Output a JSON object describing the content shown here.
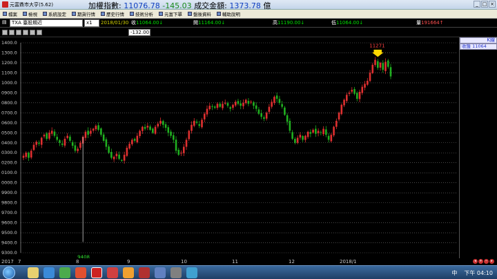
{
  "app": {
    "title": "元富鼎市大亨(5.62)",
    "index_label": "加權指數:",
    "index_value": "11076.78",
    "index_change": "-145.03",
    "turnover_label": "成交金額:",
    "turnover_value": "1373.78",
    "turnover_unit": "億"
  },
  "toolbar": {
    "items": [
      "檔案",
      "檢視",
      "系統設定",
      "期貨行情",
      "歷史行情",
      "技術分析",
      "元富下單",
      "盤後資料",
      "輔助說明"
    ]
  },
  "quote": {
    "symbol": "TXA  臺股期近",
    "period": "x1",
    "date": "2018/01/30",
    "close_label": "收",
    "close": "11064.00↓",
    "open_label": "開",
    "open": "11164.00↓",
    "high_label": "高",
    "high": "11190.00↓",
    "low_label": "低",
    "low": "11064.00↓",
    "vol_label": "量",
    "vol": "191664↑",
    "change": "-132.00"
  },
  "panel": {
    "title": "K線",
    "close_label": "收盤",
    "close_value": "11064"
  },
  "chart_data": {
    "type": "candlestick",
    "y_tick_labels": [
      "1400.0",
      "1300.0",
      "1200.0",
      "1100.0",
      "1000.0",
      "0900.0",
      "0800.0",
      "0700.0",
      "0600.0",
      "0500.0",
      "0400.0",
      "0300.0",
      "0200.0",
      "0100.0",
      "0000.0",
      "9900.0",
      "9800.0",
      "9700.0",
      "9600.0",
      "9500.0",
      "9400.0",
      "9300.0"
    ],
    "ylim": [
      9300,
      11400
    ],
    "x_tick_labels": [
      "2017",
      "7",
      "8",
      "9",
      "10",
      "11",
      "12",
      "2018/1"
    ],
    "annotations": {
      "high_label": "11271",
      "low_label": "9408"
    },
    "colors": {
      "up": "#e03030",
      "down": "#20b020",
      "grid": "#7a7a7a",
      "axis_text": "#cccccc",
      "marker": "#ffd700"
    },
    "closes": [
      10270,
      10300,
      10250,
      10320,
      10380,
      10410,
      10390,
      10450,
      10480,
      10440,
      10500,
      10520,
      10470,
      10430,
      10400,
      10380,
      10440,
      10470,
      10420,
      10370,
      10320,
      10340,
      10400,
      10460,
      10510,
      10480,
      10520,
      10540,
      10570,
      10530,
      10480,
      10420,
      10360,
      10300,
      10250,
      10260,
      10290,
      10240,
      10220,
      10280,
      10350,
      10390,
      10430,
      10420,
      10470,
      10520,
      10560,
      10540,
      10570,
      10530,
      10500,
      10560,
      10590,
      10620,
      10580,
      10550,
      10500,
      10470,
      10430,
      10320,
      10280,
      10300,
      10360,
      10430,
      10520,
      10580,
      10620,
      10600,
      10570,
      10630,
      10690,
      10740,
      10770,
      10760,
      10750,
      10790,
      10760,
      10790,
      10800,
      10770,
      10740,
      10780,
      10810,
      10790,
      10770,
      10800,
      10830,
      10790,
      10810,
      10770,
      10740,
      10690,
      10660,
      10640,
      10700,
      10760,
      10810,
      10860,
      10840,
      10800,
      10760,
      10680,
      10610,
      10520,
      10440,
      10400,
      10450,
      10480,
      10430,
      10470,
      10510,
      10490,
      10530,
      10490,
      10520,
      10500,
      10540,
      10480,
      10430,
      10480,
      10560,
      10620,
      10700,
      10780,
      10830,
      10880,
      10900,
      10930,
      10890,
      10840,
      10910,
      10960,
      10990,
      11020,
      11100,
      11180,
      11230,
      11150,
      11200,
      11130,
      11210,
      11160,
      11064
    ]
  },
  "xaxis": {
    "labels": [
      "2017",
      "7",
      "8",
      "9",
      "10",
      "11",
      "12",
      "2018/1"
    ]
  },
  "taskbar": {
    "ime": "中",
    "clock": "下午 04:10"
  }
}
